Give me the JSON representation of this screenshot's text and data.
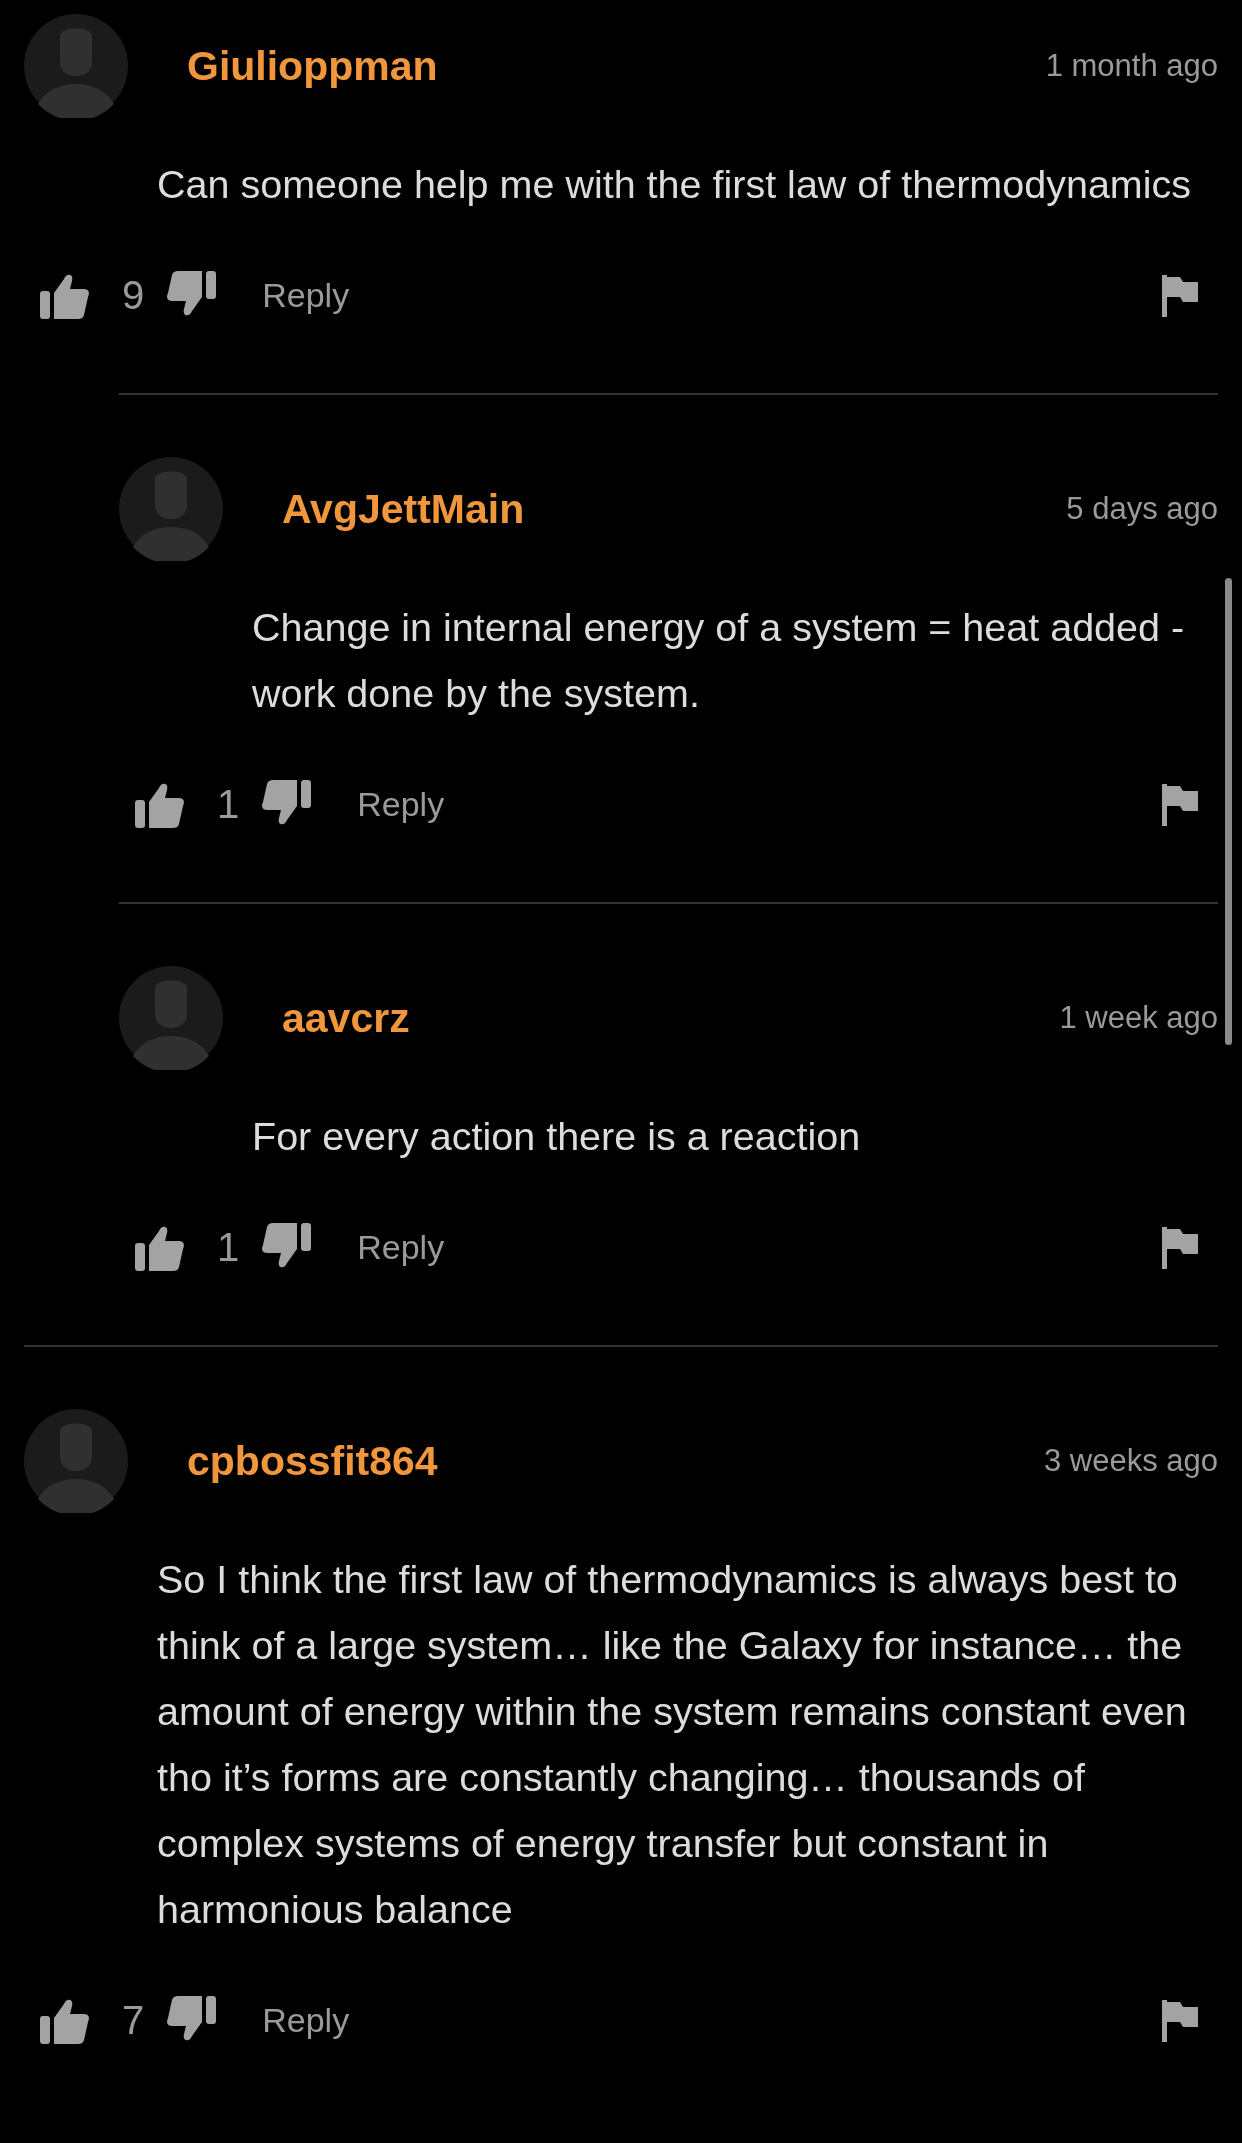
{
  "comments": [
    {
      "username": "Giulioppman",
      "time": "1 month ago",
      "text": "Can someone help me with the first law of thermodynamics",
      "likes": "9",
      "reply": "Reply",
      "replies": [
        {
          "username": "AvgJettMain",
          "time": "5 days ago",
          "text": "Change in internal energy of a system = heat added - work done by the system.",
          "likes": "1",
          "reply": "Reply"
        },
        {
          "username": "aavcrz",
          "time": "1 week ago",
          "text": "For every action there is a reaction",
          "likes": "1",
          "reply": "Reply"
        }
      ]
    },
    {
      "username": "cpbossfit864",
      "time": "3 weeks ago",
      "text": "So I think the first law of thermodynamics is always best to think of a large system… like the Galaxy for instance… the amount of energy within the system remains constant even tho it’s forms are constantly changing… thousands of complex systems of energy transfer but constant in harmonious balance",
      "likes": "7",
      "reply": "Reply"
    }
  ]
}
